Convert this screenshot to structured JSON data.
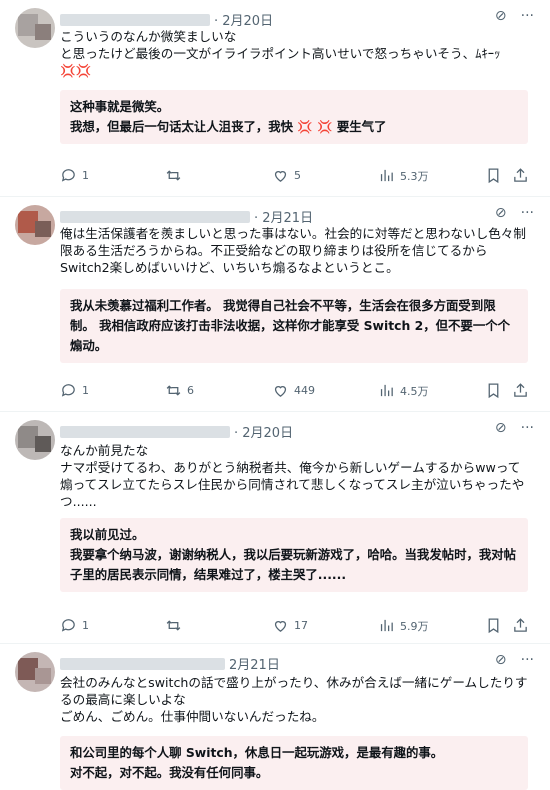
{
  "posts": [
    {
      "date": "· 2月20日",
      "text": "こういうのなんか微笑ましいな\nと思ったけど最後の一文がイライラポイント高いせいで怒っちゃいそう、ﾑｷｰｯ💢💢",
      "translation": "这种事就是微笑。\n我想，但最后一句话太让人沮丧了，我快 💢 💢 要生气了",
      "actions": {
        "replies": "1",
        "retweets": "",
        "likes": "5",
        "views": "5.3万"
      }
    },
    {
      "date": "· 2月21日",
      "text": "俺は生活保護者を羨ましいと思った事はない。社会的に対等だと思わないし色々制限ある生活だろうからね。不正受給などの取り締まりは役所を信じてるからSwitch2楽しめばいいけど、いちいち煽るなよというとこ。",
      "translation": "我从未羡慕过福利工作者。 我觉得自己社会不平等，生活会在很多方面受到限制。 我相信政府应该打击非法收据，这样你才能享受 Switch 2，但不要一个个煽动。",
      "actions": {
        "replies": "1",
        "retweets": "6",
        "likes": "449",
        "views": "4.5万"
      }
    },
    {
      "date": "· 2月20日",
      "text": "なんか前見たな\nナマポ受けてるわ、ありがとう納税者共、俺今から新しいゲームするからwwって煽ってスレ立てたらスレ住民から同情されて悲しくなってスレ主が泣いちゃったやつ......",
      "translation": "我以前见过。\n我要拿个纳马波，谢谢纳税人，我以后要玩新游戏了，哈哈。当我发帖时，我对帖子里的居民表示同情，结果难过了，楼主哭了......",
      "actions": {
        "replies": "1",
        "retweets": "",
        "likes": "17",
        "views": "5.9万"
      }
    },
    {
      "date": "2月21日",
      "text": "会社のみんなとswitchの話で盛り上がったり、休みが合えば一緒にゲームしたりするの最高に楽しいよな\nごめん、ごめん。仕事仲間いないんだったね。",
      "translation": "和公司里的每个人聊 Switch，休息日一起玩游戏，是最有趣的事。\n对不起，对不起。我没有任何同事。",
      "actions": {}
    }
  ],
  "icons": [
    "grok-icon",
    "more-icon",
    "reply-icon",
    "retweet-icon",
    "like-icon",
    "views-icon",
    "bookmark-icon",
    "share-icon"
  ]
}
